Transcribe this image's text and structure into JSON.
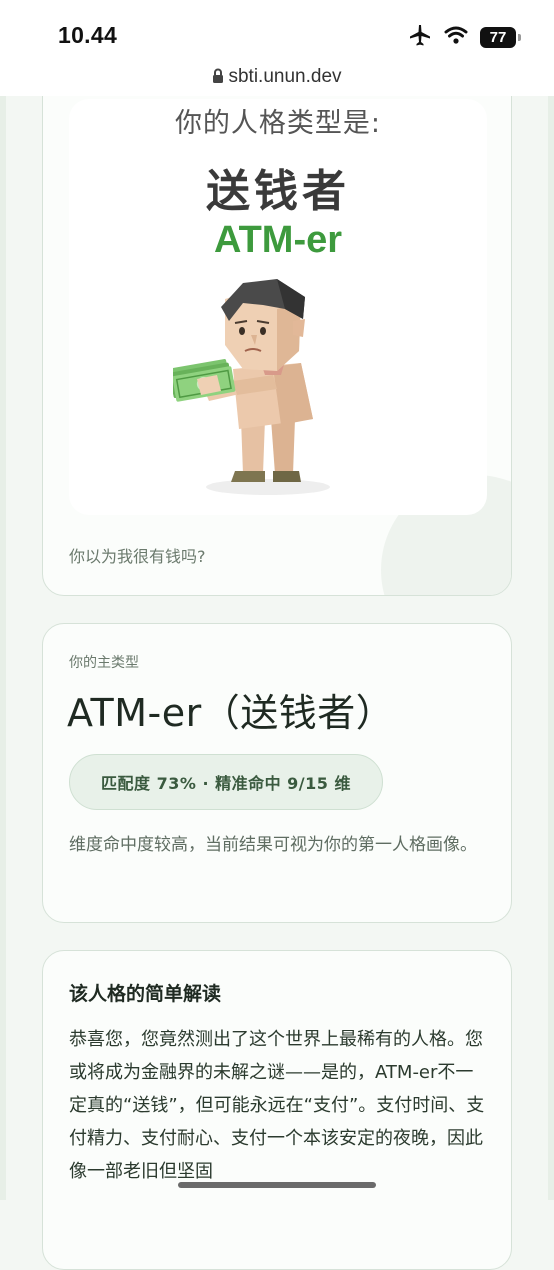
{
  "status_bar": {
    "time": "10.44",
    "battery": "77",
    "icons": [
      "airplane-icon",
      "wifi-icon",
      "battery-icon"
    ]
  },
  "browser": {
    "url": "sbti.unun.dev"
  },
  "result_card": {
    "poster_intro": "你的人格类型是:",
    "poster_type_cn": "送钱者",
    "poster_type_en": "ATM-er",
    "quote": "你以为我很有钱吗?"
  },
  "main_type_card": {
    "label": "你的主类型",
    "type": "ATM-er（送钱者）",
    "match_badge": "匹配度 73% · 精准命中 9/15 维",
    "match_value_percent": 73,
    "note": "维度命中度较高，当前结果可视为你的第一人格画像。"
  },
  "interpretation_card": {
    "title": "该人格的简单解读",
    "body": "恭喜您，您竟然测出了这个世界上最稀有的人格。您或将成为金融界的未解之谜——是的，ATM-er不一定真的“送钱”，但可能永远在“支付”。支付时间、支付精力、支付耐心、支付一个本该安定的夜晚，因此像一部老旧但坚固"
  },
  "colors": {
    "accent_green": "#3d9a3d",
    "background": "#f3f7f3",
    "card_border": "#d6e2d8"
  }
}
